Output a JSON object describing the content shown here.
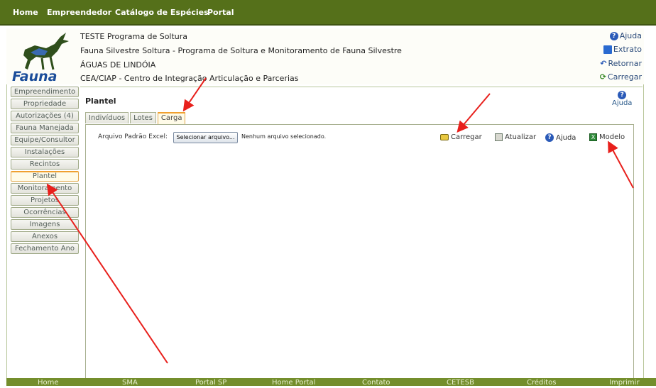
{
  "topnav": {
    "items": [
      "Home",
      "Empreendedor",
      "Catálogo de Espécies",
      "Portal"
    ]
  },
  "header": {
    "logo_text": "Fauna",
    "lines": [
      "TESTE Programa de Soltura",
      "Fauna Silvestre Soltura - Programa de Soltura e Monitoramento de Fauna Silvestre",
      "ÁGUAS DE LINDÓIA",
      "CEA/CIAP - Centro de Integração Articulação e Parcerias"
    ],
    "right_links": [
      "Ajuda",
      "Extrato",
      "Retornar",
      "Carregar"
    ]
  },
  "sidebar": {
    "items": [
      "Empreendimento",
      "Propriedade",
      "Autorizações (4)",
      "Fauna Manejada",
      "Equipe/Consultor",
      "Instalações",
      "Recintos",
      "Plantel",
      "Monitoramento",
      "Projetos",
      "Ocorrências",
      "Imagens",
      "Anexos",
      "Fechamento Ano"
    ],
    "active": "Plantel"
  },
  "main": {
    "title": "Plantel",
    "ajuda_label": "Ajuda",
    "tabs": [
      "Indivíduos",
      "Lotes",
      "Carga"
    ],
    "active_tab": "Carga",
    "file_label": "Arquivo Padrão Excel:",
    "file_button": "Selecionar arquivo...",
    "file_status": "Nenhum arquivo selecionado.",
    "toolbar": [
      "Carregar",
      "Atualizar",
      "Ajuda",
      "Modelo"
    ]
  },
  "footer": {
    "links": [
      "Home",
      "SMA",
      "Portal SP",
      "Home Portal",
      "Contato",
      "CETESB",
      "Créditos",
      "Imprimir"
    ]
  },
  "colors": {
    "nav_bg": "#55701a",
    "footer_bg": "#748e2c",
    "active_tab_border": "#f0a030",
    "annotation_arrow": "#e8201c"
  }
}
